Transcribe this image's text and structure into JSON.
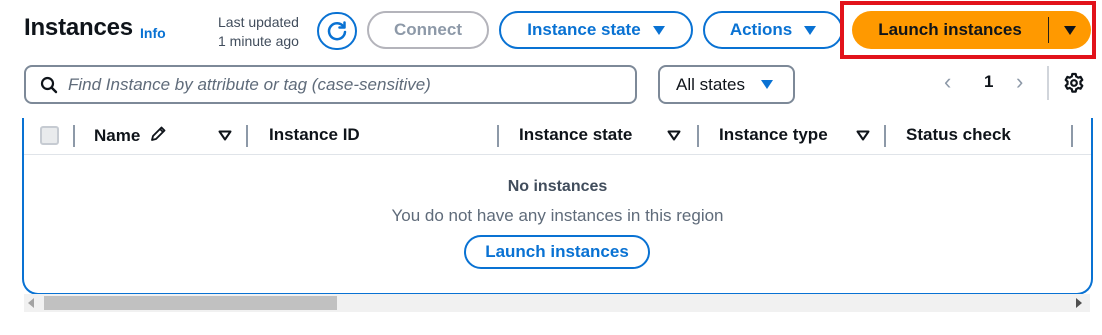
{
  "header": {
    "title": "Instances",
    "info_link": "Info",
    "last_updated_label": "Last updated",
    "last_updated_value": "1 minute ago"
  },
  "toolbar": {
    "refresh_icon": "refresh-icon",
    "connect_label": "Connect",
    "instance_state_label": "Instance state",
    "actions_label": "Actions",
    "launch_instances_label": "Launch instances"
  },
  "search": {
    "placeholder": "Find Instance by attribute or tag (case-sensitive)",
    "value": ""
  },
  "filter": {
    "selected": "All states"
  },
  "pagination": {
    "current_page": "1",
    "prev_symbol": "‹",
    "next_symbol": "›"
  },
  "table": {
    "columns": [
      "Name",
      "Instance ID",
      "Instance state",
      "Instance type",
      "Status check"
    ],
    "rows": [],
    "empty_title": "No instances",
    "empty_message": "You do not have any instances in this region",
    "empty_action_label": "Launch instances"
  },
  "colors": {
    "accent": "#0972d3",
    "primary_button": "#ff9900",
    "highlight_box": "#e2121a"
  }
}
